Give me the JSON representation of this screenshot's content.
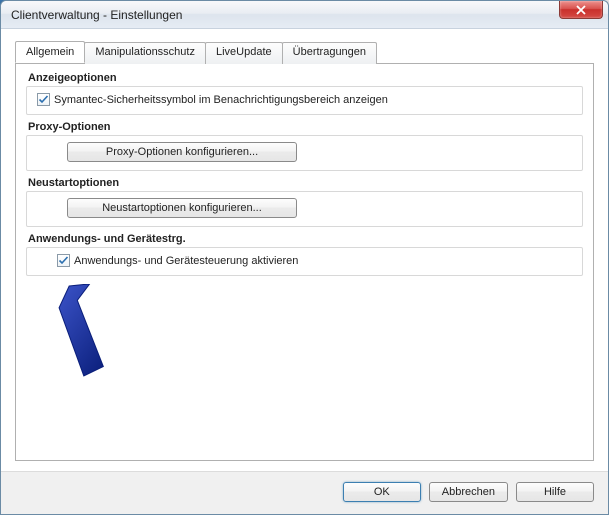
{
  "window": {
    "title": "Clientverwaltung - Einstellungen"
  },
  "tabs": {
    "t0": "Allgemein",
    "t1": "Manipulationsschutz",
    "t2": "LiveUpdate",
    "t3": "Übertragungen"
  },
  "groups": {
    "display": {
      "title": "Anzeigeoptionen",
      "checkbox_label": "Symantec-Sicherheitssymbol im Benachrichtigungsbereich anzeigen",
      "checked": true
    },
    "proxy": {
      "title": "Proxy-Optionen",
      "button_label": "Proxy-Optionen konfigurieren..."
    },
    "restart": {
      "title": "Neustartoptionen",
      "button_label": "Neustartoptionen konfigurieren..."
    },
    "appdev": {
      "title": "Anwendungs- und Gerätestrg.",
      "checkbox_label": "Anwendungs- und Gerätesteuerung aktivieren",
      "checked": true
    }
  },
  "footer": {
    "ok": "OK",
    "cancel": "Abbrechen",
    "help": "Hilfe"
  }
}
